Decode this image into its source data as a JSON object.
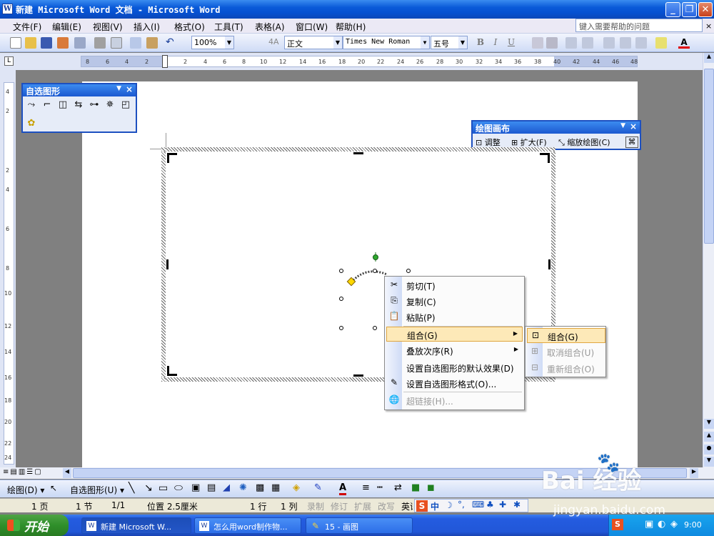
{
  "window": {
    "title": "新建 Microsoft Word 文档 - Microsoft Word"
  },
  "menubar": {
    "items": [
      "文件(F)",
      "编辑(E)",
      "视图(V)",
      "插入(I)",
      "格式(O)",
      "工具(T)",
      "表格(A)",
      "窗口(W)",
      "帮助(H)"
    ],
    "help_placeholder": "键入需要帮助的问题",
    "doc_close": "×"
  },
  "toolbar": {
    "zoom": "100%",
    "style": "正文",
    "font": "Times New Roman",
    "font_size": "五号",
    "bold": "B",
    "italic": "I",
    "underline": "U",
    "font_color": "A"
  },
  "ruler": {
    "ticks": [
      "8",
      "6",
      "4",
      "2",
      "2",
      "4",
      "6",
      "8",
      "10",
      "12",
      "14",
      "16",
      "18",
      "20",
      "22",
      "24",
      "26",
      "28",
      "30",
      "32",
      "34",
      "36",
      "38",
      "40",
      "42",
      "44",
      "46",
      "48"
    ],
    "vticks": [
      "4",
      "2",
      "2",
      "4",
      "6",
      "8",
      "10",
      "12",
      "14",
      "16",
      "18",
      "20",
      "22",
      "24"
    ]
  },
  "autoshapes_bar": {
    "title": "自选图形",
    "close": "×"
  },
  "canvas_bar": {
    "title": "绘图画布",
    "fit": "调整",
    "expand": "扩大(F)",
    "scale": "缩放绘图(C)",
    "close": "×"
  },
  "context_menu": {
    "items": [
      "剪切(T)",
      "复制(C)",
      "粘贴(P)",
      "组合(G)",
      "叠放次序(R)",
      "设置自选图形的默认效果(D)",
      "设置自选图形格式(O)...",
      "超链接(H)..."
    ]
  },
  "submenu": {
    "items": [
      "组合(G)",
      "取消组合(U)",
      "重新组合(O)"
    ]
  },
  "drawbar": {
    "draw": "绘图(D)",
    "autoshapes": "自选图形(U)"
  },
  "statusbar": {
    "page": "1 页",
    "section": "1 节",
    "pages": "1/1",
    "position": "位置 2.5厘米",
    "line": "1 行",
    "column": "1 列",
    "rec": "录制",
    "trk": "修订",
    "ext": "扩展",
    "ovr": "改写",
    "lang": "英语"
  },
  "ime": {
    "label": "中"
  },
  "taskbar": {
    "start": "开始",
    "tasks": [
      "新建 Microsoft W...",
      "怎么用word制作物...",
      "15 - 画图"
    ],
    "clock": "9:00"
  },
  "watermark": {
    "brand": "Bai 经验",
    "url": "jingyan.baidu.com"
  }
}
